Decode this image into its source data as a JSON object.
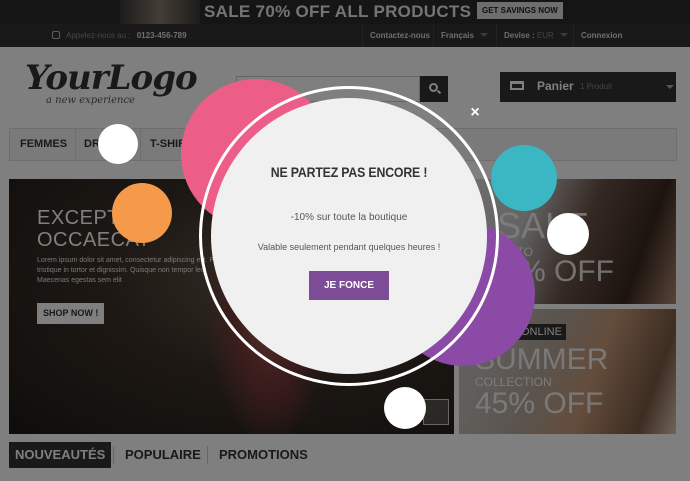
{
  "promo": {
    "text": "SALE 70% OFF ALL PRODUCTS",
    "button": "GET SAVINGS NOW"
  },
  "topnav": {
    "call_label": "Appelez-nous au :",
    "phone": "0123-456-789",
    "contact": "Contactez-nous",
    "language": "Français",
    "currency_label": "Devise :",
    "currency_value": "EUR",
    "login": "Connexion"
  },
  "header": {
    "logo": "YourLogo",
    "tagline": "a new experience",
    "cart_label": "Panier",
    "cart_count": "1 Produit"
  },
  "menu": {
    "items": [
      "FEMMES",
      "DR",
      "T-SHIRT"
    ]
  },
  "hero": {
    "title_line1": "EXCEPT",
    "title_line2": "OCCAECAT",
    "text": "Lorem ipsum dolor sit amet, consectetur adipiscing elit. Proin tristique in tortor et dignissim. Quisque non tempor leo. Maecenas egestas sem elit",
    "button": "SHOP NOW !"
  },
  "side_banners": {
    "b1_big": "SALE",
    "b1_mid": "UP TO",
    "b1_off": "% OFF",
    "b2_tag": "ONLINE",
    "b2_big": "SUMMER",
    "b2_small": "COLLECTION",
    "b2_off": "45% OFF"
  },
  "tabs": {
    "items": [
      "NOUVEAUTÉS",
      "POPULAIRE",
      "PROMOTIONS"
    ]
  },
  "popup": {
    "title": "NE PARTEZ PAS ENCORE !",
    "subtitle": "-10% sur toute la boutique",
    "note": "Valable seulement pendant quelques heures !",
    "button": "JE FONCE",
    "close": "×"
  },
  "colors": {
    "accent_purple": "#7c4d96",
    "deco_pink": "#ec5e88",
    "deco_orange": "#f59a4a",
    "deco_teal": "#3bb6c3",
    "deco_purple": "#8a4aa6"
  }
}
